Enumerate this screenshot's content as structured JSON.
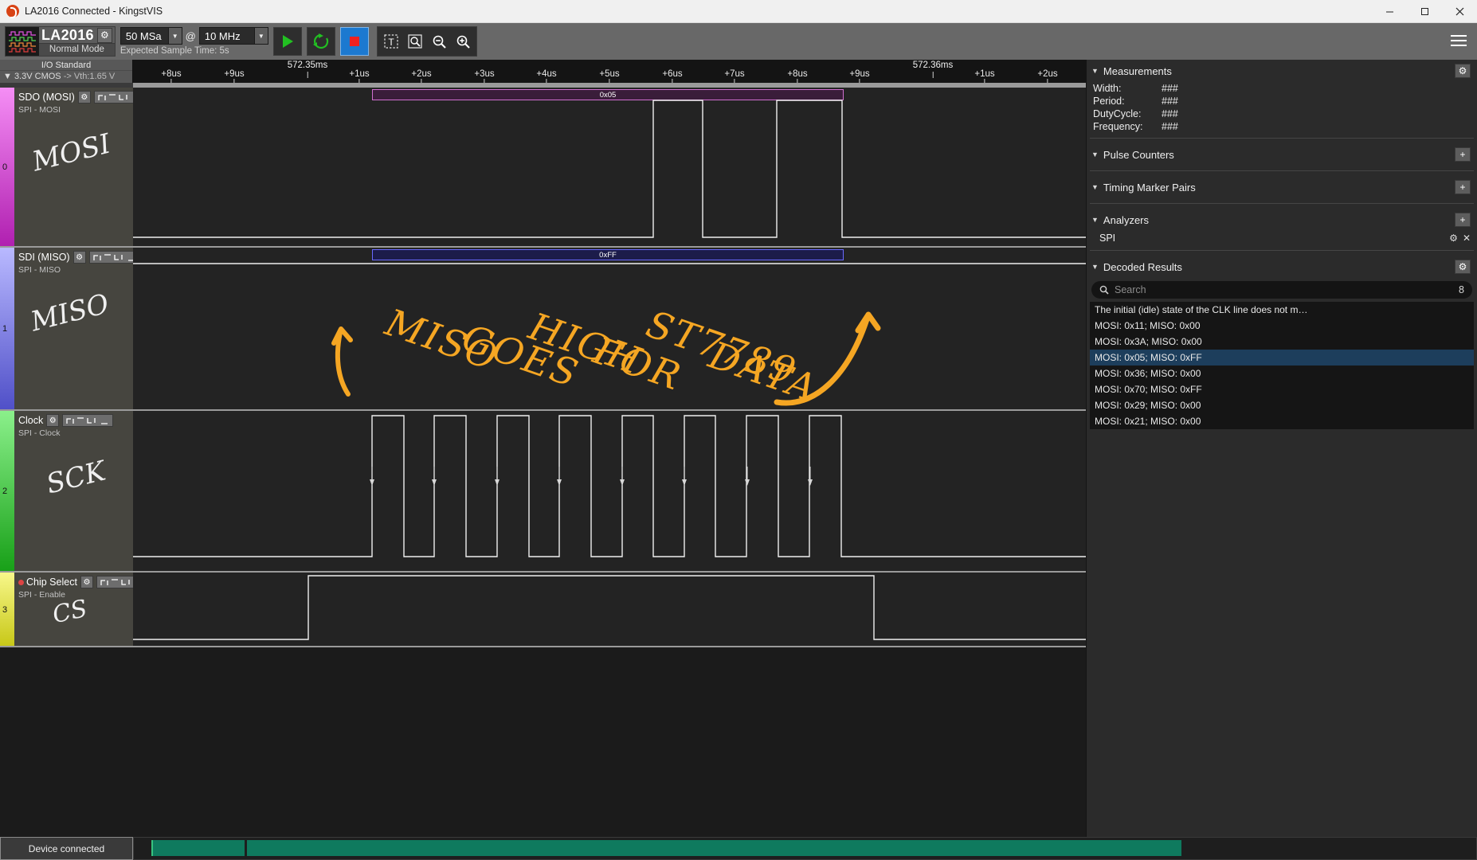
{
  "window": {
    "title": "LA2016 Connected - KingstVIS",
    "minimize_label": "—",
    "maximize_label": "□",
    "close_label": "✕"
  },
  "toolbar": {
    "device_name": "LA2016",
    "device_mode": "Normal Mode",
    "settings_icon": "gear-icon",
    "sample_depth": "50 MSa",
    "at_symbol": "@",
    "sample_rate": "10 MHz",
    "expected_time": "Expected Sample Time: 5s",
    "start_label": "start-capture-icon",
    "loop_label": "repeat-capture-icon",
    "stop_label": "stop-capture-icon",
    "text_tool": "text-annotation-icon",
    "zoom_fit": "zoom-fit-icon",
    "zoom_out": "zoom-out-icon",
    "zoom_in": "zoom-in-icon",
    "menu_icon": "hamburger-menu-icon"
  },
  "io_header": {
    "title": "I/O Standard",
    "standard": "▼ 3.3V CMOS",
    "threshold": "-> Vth:1.65 V"
  },
  "ruler": {
    "major_labels": [
      "572.35ms",
      "572.36ms"
    ],
    "ticks": [
      "+8us",
      "+9us",
      "+1us",
      "+2us",
      "+3us",
      "+4us",
      "+5us",
      "+6us",
      "+7us",
      "+8us",
      "+9us",
      "+1us",
      "+2us"
    ]
  },
  "channels": [
    {
      "index": "0",
      "name": "SDO (MOSI)",
      "sub": "SPI - MOSI",
      "color": "#e255e2",
      "annotation": "MOSI",
      "databar": {
        "text": "0x05",
        "border": "#d06fd0",
        "fill": "#3a1d3a"
      }
    },
    {
      "index": "1",
      "name": "SDI (MISO)",
      "sub": "SPI - MISO",
      "color": "#8a8aff",
      "annotation": "MISO",
      "databar": {
        "text": "0xFF",
        "border": "#6a6aff",
        "fill": "#1c1c4a"
      }
    },
    {
      "index": "2",
      "name": "Clock",
      "sub": "SPI - Clock",
      "color": "#55d455",
      "annotation": "SCK",
      "databar": null
    },
    {
      "index": "3",
      "name": "Chip Select",
      "sub": "SPI - Enable",
      "color": "#e8e84a",
      "annotation": "CS",
      "databar": null
    }
  ],
  "overlay_note": {
    "text": "MISO GOES HIGH FOR ST7789 DATA",
    "color": "#f5a623",
    "words": [
      "MISO",
      "GOES",
      "HIGH",
      "FOR",
      "ST7789",
      "DATA"
    ]
  },
  "right_panel": {
    "measurements": {
      "title": "Measurements",
      "settings_icon": "gear-icon",
      "rows": [
        {
          "key": "Width:",
          "value": "###"
        },
        {
          "key": "Period:",
          "value": "###"
        },
        {
          "key": "DutyCycle:",
          "value": "###"
        },
        {
          "key": "Frequency:",
          "value": "###"
        }
      ]
    },
    "pulse_counters": {
      "title": "Pulse Counters",
      "add_icon": "plus-icon"
    },
    "timing_marker_pairs": {
      "title": "Timing Marker Pairs",
      "add_icon": "plus-icon"
    },
    "analyzers": {
      "title": "Analyzers",
      "add_icon": "plus-icon",
      "items": [
        {
          "name": "SPI",
          "settings_icon": "gear-icon",
          "remove_icon": "close-icon"
        }
      ]
    },
    "decoded_results": {
      "title": "Decoded Results",
      "settings_icon": "gear-icon",
      "search_placeholder": "Search",
      "search_value": "",
      "result_count": "8",
      "items": [
        {
          "text": "The initial (idle) state of the CLK line does not m…",
          "selected": false
        },
        {
          "text": "MOSI: 0x11;  MISO: 0x00",
          "selected": false
        },
        {
          "text": "MOSI: 0x3A;  MISO: 0x00",
          "selected": false
        },
        {
          "text": "MOSI: 0x05;  MISO: 0xFF",
          "selected": true
        },
        {
          "text": "MOSI: 0x36;  MISO: 0x00",
          "selected": false
        },
        {
          "text": "MOSI: 0x70;  MISO: 0xFF",
          "selected": false
        },
        {
          "text": "MOSI: 0x29;  MISO: 0x00",
          "selected": false
        },
        {
          "text": "MOSI: 0x21;  MISO: 0x00",
          "selected": false
        }
      ]
    }
  },
  "statusbar": {
    "text": "Device connected"
  }
}
